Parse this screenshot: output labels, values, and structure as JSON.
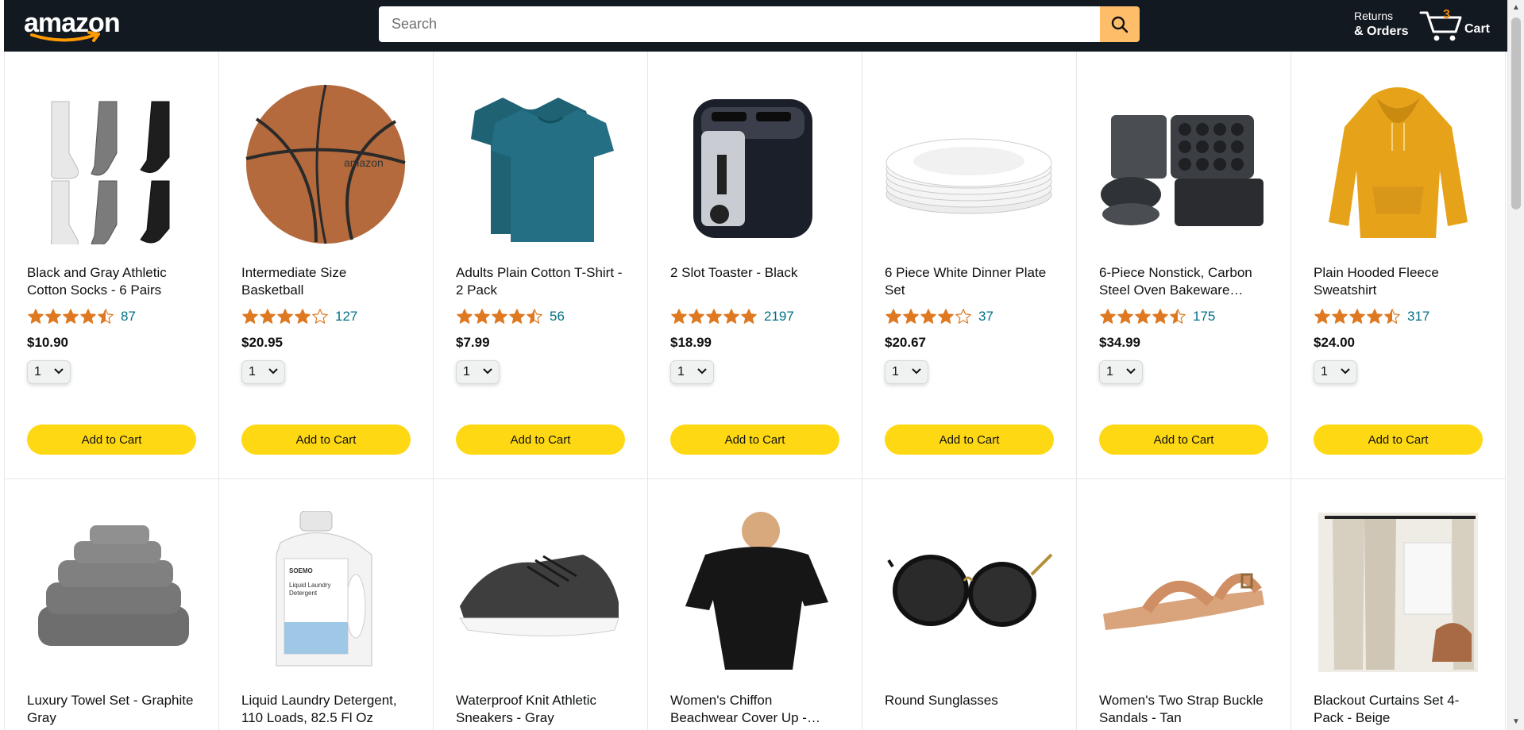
{
  "header": {
    "logo_text": "amazon",
    "search_placeholder": "Search",
    "returns_top": "Returns",
    "returns_bottom": "& Orders",
    "cart_count": "3",
    "cart_label": "Cart"
  },
  "products": [
    {
      "title": "Black and Gray Athletic Cotton Socks - 6 Pairs",
      "rating": 4.5,
      "reviews": "87",
      "price": "$10.90",
      "qty": "1",
      "button": "Add to Cart",
      "image": "socks-image"
    },
    {
      "title": "Intermediate Size Basketball",
      "rating": 4.0,
      "reviews": "127",
      "price": "$20.95",
      "qty": "1",
      "button": "Add to Cart",
      "image": "basketball-image"
    },
    {
      "title": "Adults Plain Cotton T-Shirt - 2 Pack",
      "rating": 4.5,
      "reviews": "56",
      "price": "$7.99",
      "qty": "1",
      "button": "Add to Cart",
      "image": "tshirt-image"
    },
    {
      "title": "2 Slot Toaster - Black",
      "rating": 5.0,
      "reviews": "2197",
      "price": "$18.99",
      "qty": "1",
      "button": "Add to Cart",
      "image": "toaster-image"
    },
    {
      "title": "6 Piece White Dinner Plate Set",
      "rating": 4.0,
      "reviews": "37",
      "price": "$20.67",
      "qty": "1",
      "button": "Add to Cart",
      "image": "plates-image"
    },
    {
      "title": "6-Piece Nonstick, Carbon Steel Oven Bakeware…",
      "rating": 4.5,
      "reviews": "175",
      "price": "$34.99",
      "qty": "1",
      "button": "Add to Cart",
      "image": "bakeware-image"
    },
    {
      "title": "Plain Hooded Fleece Sweatshirt",
      "rating": 4.5,
      "reviews": "317",
      "price": "$24.00",
      "qty": "1",
      "button": "Add to Cart",
      "image": "hoodie-image"
    }
  ],
  "products_row2": [
    {
      "title": "Luxury Towel Set - Graphite Gray",
      "image": "towels-image"
    },
    {
      "title": "Liquid Laundry Detergent, 110 Loads, 82.5 Fl Oz",
      "image": "detergent-image"
    },
    {
      "title": "Waterproof Knit Athletic Sneakers - Gray",
      "image": "sneaker-image"
    },
    {
      "title": "Women's Chiffon Beachwear Cover Up -…",
      "image": "coverup-image"
    },
    {
      "title": "Round Sunglasses",
      "image": "sunglasses-image"
    },
    {
      "title": "Women's Two Strap Buckle Sandals - Tan",
      "image": "sandals-image"
    },
    {
      "title": "Blackout Curtains Set 4-Pack - Beige",
      "image": "curtains-image"
    }
  ],
  "detergent_label": {
    "brand": "SOEMO",
    "line1": "Liquid Laundry",
    "line2": "Detergent"
  },
  "colors": {
    "header_bg": "#131921",
    "search_button": "#febd69",
    "add_button": "#ffd814",
    "star": "#de7921",
    "link": "#007185",
    "cart_count": "#f08804"
  }
}
